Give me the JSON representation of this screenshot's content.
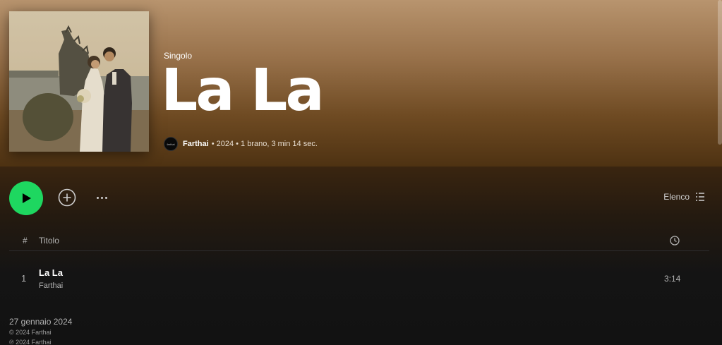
{
  "album": {
    "type_label": "Singolo",
    "title": "La La",
    "artist": "Farthai",
    "artist_avatar_text": "farthai",
    "byline_rest": "• 2024 • 1 brano, 3 min 14 sec."
  },
  "controls": {
    "view_label": "Elenco"
  },
  "table": {
    "header_num": "#",
    "header_title": "Titolo"
  },
  "tracks": [
    {
      "num": "1",
      "title": "La La",
      "artist": "Farthai",
      "duration": "3:14"
    }
  ],
  "release": {
    "date": "27 gennaio 2024",
    "copyright_c": "© 2024 Farthai",
    "copyright_p": "℗ 2024 Farthai"
  },
  "colors": {
    "accent": "#1ed760",
    "header_top": "#b8946e",
    "header_bottom": "#4e3212",
    "background": "#121212"
  },
  "icons": {
    "play": "play-icon",
    "add": "plus-circle-icon",
    "more": "more-horizontal-icon",
    "view": "list-icon",
    "duration": "clock-icon"
  }
}
